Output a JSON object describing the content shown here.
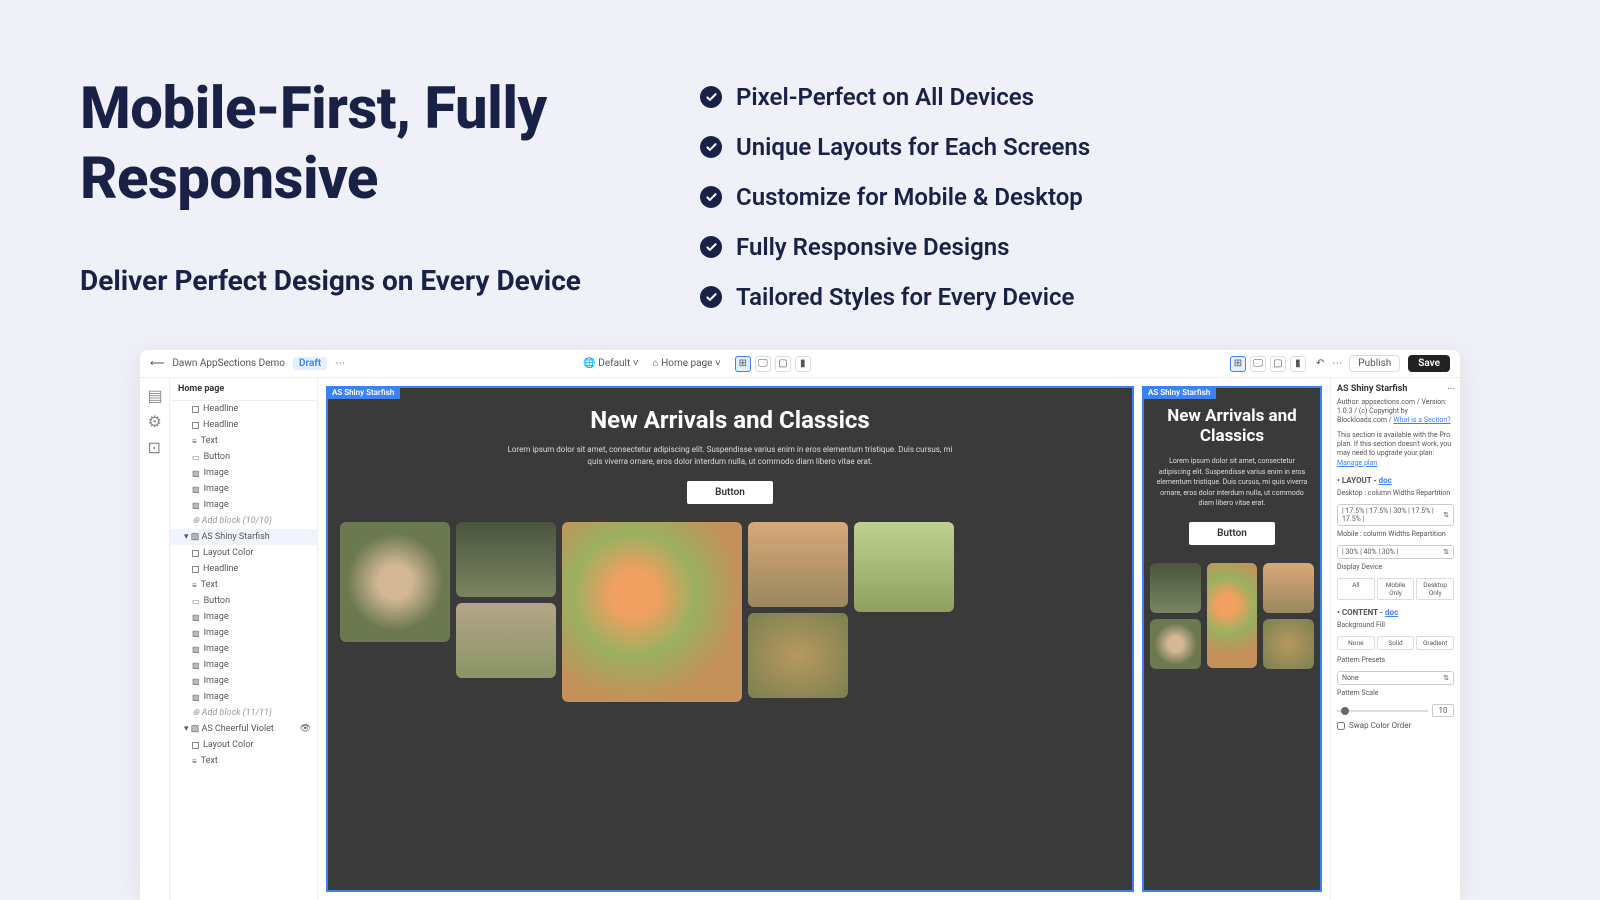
{
  "hero": {
    "title": "Mobile-First, Fully Responsive",
    "subtitle": "Deliver Perfect Designs on Every Device",
    "features": [
      "Pixel-Perfect on All Devices",
      "Unique Layouts for Each Screens",
      "Customize for Mobile & Desktop",
      "Fully Responsive Designs",
      "Tailored Styles for Every Device"
    ]
  },
  "topbar": {
    "site": "Dawn AppSections Demo",
    "status": "Draft",
    "theme": "Default",
    "page": "Home page",
    "publish": "Publish",
    "save": "Save"
  },
  "tree": {
    "header": "Home page",
    "items": [
      {
        "type": "Headline",
        "ico": "brackets"
      },
      {
        "type": "Headline",
        "ico": "brackets"
      },
      {
        "type": "Text",
        "ico": "text"
      },
      {
        "type": "Button",
        "ico": "btn"
      },
      {
        "type": "Image",
        "ico": "img"
      },
      {
        "type": "Image",
        "ico": "img"
      },
      {
        "type": "Image",
        "ico": "img"
      }
    ],
    "addblock1": "Add block (10/10)",
    "section1": "AS Shiny Starfish",
    "items2": [
      {
        "type": "Layout Color",
        "ico": "brackets"
      },
      {
        "type": "Headline",
        "ico": "brackets"
      },
      {
        "type": "Text",
        "ico": "text"
      },
      {
        "type": "Button",
        "ico": "btn"
      },
      {
        "type": "Image",
        "ico": "img"
      },
      {
        "type": "Image",
        "ico": "img"
      },
      {
        "type": "Image",
        "ico": "img"
      },
      {
        "type": "Image",
        "ico": "img"
      },
      {
        "type": "Image",
        "ico": "img"
      },
      {
        "type": "Image",
        "ico": "img"
      }
    ],
    "addblock2": "Add block (11/11)",
    "section2": "AS Cheerful Violet",
    "items3": [
      {
        "type": "Layout Color",
        "ico": "brackets"
      },
      {
        "type": "Text",
        "ico": "text"
      }
    ]
  },
  "preview": {
    "tag": "AS Shiny Starfish",
    "heading": "New Arrivals and Classics",
    "para": "Lorem ipsum dolor sit amet, consectetur adipiscing elit. Suspendisse varius enim in eros elementum tristique. Duis cursus, mi quis viverra ornare, eros dolor interdum nulla, ut commodo diam libero vitae erat.",
    "button": "Button"
  },
  "props": {
    "title": "AS Shiny Starfish",
    "author": "Author: appsections.com / Version: 1.0.3 / (c) Copyright by Blockloads.com / ",
    "whatis": "What is a Section?",
    "upgrade": "This section is available with the Pro plan. If this section doesn't work, you may need to upgrade your plan: ",
    "manage": "Manage plan",
    "layout": "LAYOUT",
    "doc": "doc",
    "desktopLabel": "Desktop : column Widths Repartition",
    "desktopVal": "| 17.5% | 17.5% | 30% | 17.5% | 17.5% |",
    "mobileLabel": "Mobile : column Widths Repartition",
    "mobileVal": "| 30% | 40% | 30% |",
    "displayDevice": "Display Device",
    "deviceTabs": [
      "All",
      "Mobile Only",
      "Desktop Only"
    ],
    "content": "CONTENT",
    "bgFill": "Background Fill",
    "bgTabs": [
      "None",
      "Solid",
      "Gradient"
    ],
    "patternPresets": "Pattern Presets",
    "patternVal": "None",
    "patternScale": "Pattern Scale",
    "scaleVal": "10",
    "swap": "Swap Color Order"
  }
}
